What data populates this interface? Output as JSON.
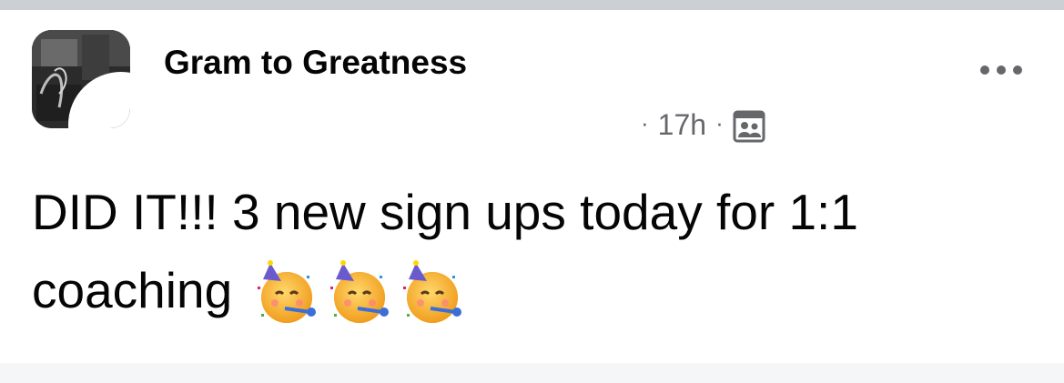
{
  "post": {
    "page_name": "Gram to Greatness",
    "timestamp": "17h",
    "separator": "·",
    "audience_icon": "friends-audience-icon",
    "text_line1": "DID IT!!! 3 new sign ups today for 1:1",
    "text_line2": "coaching",
    "emojis": [
      "partying-face-emoji",
      "partying-face-emoji",
      "partying-face-emoji"
    ],
    "more_icon": "more-options-icon"
  },
  "colors": {
    "name_text": "#050505",
    "meta_text": "#65676b",
    "top_bar": "#ccd0d5",
    "bottom_bar": "#f5f6f7"
  }
}
